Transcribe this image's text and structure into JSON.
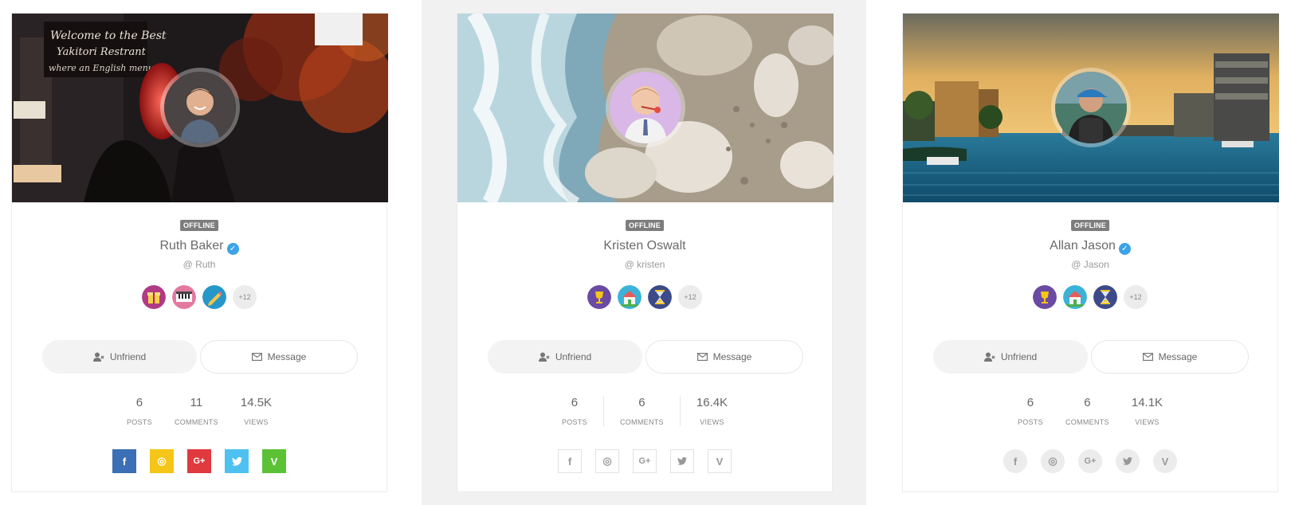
{
  "cards": [
    {
      "status": "OFFLINE",
      "name": "Ruth Baker",
      "verified": true,
      "handle": "@ Ruth",
      "badges": [
        "gift-badge-icon",
        "piano-badge-icon",
        "pencil-badge-icon"
      ],
      "badge_more": "+12",
      "unfriend_label": "Unfriend",
      "message_label": "Message",
      "stats": [
        {
          "value": "6",
          "label": "POSTS"
        },
        {
          "value": "11",
          "label": "COMMENTS"
        },
        {
          "value": "14.5K",
          "label": "VIEWS"
        }
      ],
      "social_style": "filled",
      "socials": [
        {
          "icon": "facebook-icon",
          "glyph": "f",
          "color": "#3b6fb6"
        },
        {
          "icon": "instagram-icon",
          "glyph": "◎",
          "color": "#f5c518"
        },
        {
          "icon": "google-plus-icon",
          "glyph": "G+",
          "color": "#e0393e"
        },
        {
          "icon": "twitter-icon",
          "glyph": "🐦",
          "color": "#4fc1f0"
        },
        {
          "icon": "vine-icon",
          "glyph": "V",
          "color": "#5bc236"
        }
      ]
    },
    {
      "status": "OFFLINE",
      "name": "Kristen Oswalt",
      "verified": false,
      "handle": "@ kristen",
      "badges": [
        "trophy-badge-icon",
        "house-badge-icon",
        "hourglass-badge-icon"
      ],
      "badge_more": "+12",
      "unfriend_label": "Unfriend",
      "message_label": "Message",
      "stats": [
        {
          "value": "6",
          "label": "POSTS"
        },
        {
          "value": "6",
          "label": "COMMENTS"
        },
        {
          "value": "16.4K",
          "label": "VIEWS"
        }
      ],
      "social_style": "outline",
      "socials": [
        {
          "icon": "facebook-icon",
          "glyph": "f"
        },
        {
          "icon": "instagram-icon",
          "glyph": "◎"
        },
        {
          "icon": "google-plus-icon",
          "glyph": "G+"
        },
        {
          "icon": "twitter-icon",
          "glyph": "🐦"
        },
        {
          "icon": "vine-icon",
          "glyph": "V"
        }
      ]
    },
    {
      "status": "OFFLINE",
      "name": "Allan Jason",
      "verified": true,
      "handle": "@ Jason",
      "badges": [
        "trophy-badge-icon",
        "house-badge-icon",
        "hourglass-badge-icon"
      ],
      "badge_more": "+12",
      "unfriend_label": "Unfriend",
      "message_label": "Message",
      "stats": [
        {
          "value": "6",
          "label": "POSTS"
        },
        {
          "value": "6",
          "label": "COMMENTS"
        },
        {
          "value": "14.1K",
          "label": "VIEWS"
        }
      ],
      "social_style": "circle",
      "socials": [
        {
          "icon": "facebook-icon",
          "glyph": "f"
        },
        {
          "icon": "instagram-icon",
          "glyph": "◎"
        },
        {
          "icon": "google-plus-icon",
          "glyph": "G+"
        },
        {
          "icon": "twitter-icon",
          "glyph": "🐦"
        },
        {
          "icon": "vine-icon",
          "glyph": "V"
        }
      ]
    }
  ]
}
